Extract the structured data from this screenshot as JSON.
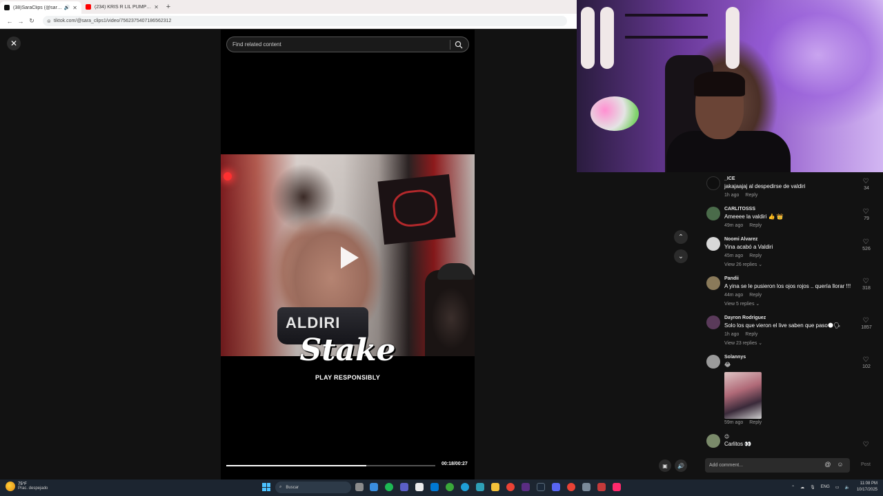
{
  "browser": {
    "tabs": [
      {
        "title": "(38)SaraClips (@sara_clips1)",
        "active": true
      },
      {
        "title": "(234) KRIS R LIL PUMP - YouTube",
        "active": false
      }
    ],
    "url": "tiktok.com/@sara_clips1/video/7562375407186562312"
  },
  "player": {
    "search_placeholder": "Find related content",
    "overlay_title": "Stake",
    "overlay_subtitle": "PLAY RESPONSIBLY",
    "top_text": "ALDIRI",
    "time": "00:18/00:27",
    "progress": 0.67
  },
  "comments": [
    {
      "user": "_ICE",
      "text": "jakajaajaj al despedirse de valdiri",
      "time": "1h ago",
      "reply": "Reply",
      "likes": "34",
      "replies": ""
    },
    {
      "user": "CARLITOSSS",
      "text": "Ameeee la valdiri 👍 👑",
      "time": "49m ago",
      "reply": "Reply",
      "likes": "79",
      "replies": ""
    },
    {
      "user": "Noomi Alvarez",
      "text": "Yina acabó a Valdiri",
      "time": "45m ago",
      "reply": "Reply",
      "likes": "526",
      "replies": "View 26 replies ⌄"
    },
    {
      "user": "Pandii",
      "text": "A yina se le pusieron los ojos rojos .. quería llorar !!!",
      "time": "44m ago",
      "reply": "Reply",
      "likes": "318",
      "replies": "View 5 replies ⌄"
    },
    {
      "user": "Dayron Rodriguez",
      "text": "Solo los que vieron el live saben que paso🌑🗣",
      "time": "1h ago",
      "reply": "Reply",
      "likes": "1857",
      "replies": "View 23 replies ⌄"
    },
    {
      "user": "Solannys",
      "text": "😂",
      "time": "59m ago",
      "reply": "Reply",
      "likes": "102",
      "replies": ""
    },
    {
      "user": "😉",
      "text": "Carlitos 👀",
      "time": "",
      "reply": "",
      "likes": "",
      "replies": ""
    }
  ],
  "comment_box": {
    "placeholder": "Add comment...",
    "post": "Post"
  },
  "taskbar": {
    "temp": "75°F",
    "condition": "Prac. despejado",
    "search": "Buscar",
    "lang": "ENG",
    "time": "11:08 PM",
    "date": "10/17/2025"
  },
  "icons": {
    "close": "close-icon",
    "search": "search-icon",
    "nav_up": "chevron-up-icon",
    "nav_down": "chevron-down-icon",
    "heart": "heart-icon"
  }
}
